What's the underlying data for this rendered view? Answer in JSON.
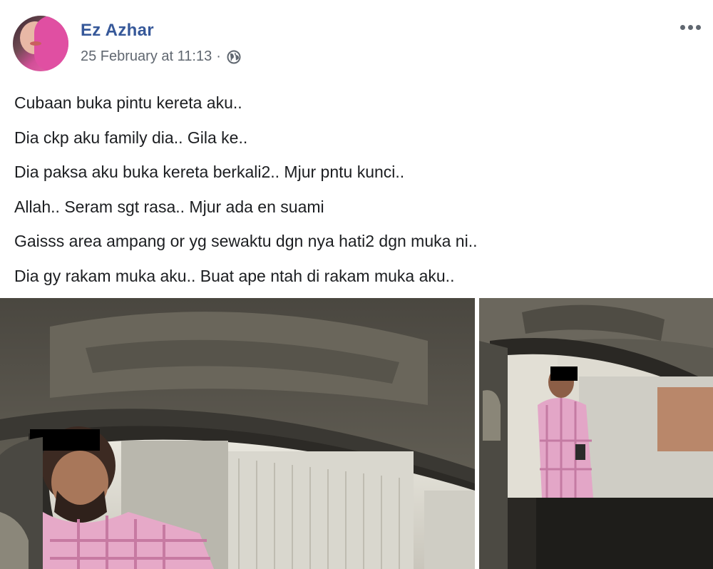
{
  "post": {
    "author": "Ez Azhar",
    "timestamp": "25 February at 11:13",
    "separator": "·",
    "privacy_icon": "globe-icon",
    "more_icon": "more-options-icon",
    "lines": [
      "Cubaan buka pintu kereta aku..",
      "Dia ckp aku family dia.. Gila ke..",
      "Dia paksa aku buka kereta berkali2.. Mjur pntu kunci..",
      "Allah.. Seram sgt rasa.. Mjur ada en suami",
      "Gaisss area ampang or yg sewaktu dgn nya hati2 dgn muka ni..",
      "Dia gy rakam muka aku.. Buat ape ntah di rakam muka aku.."
    ]
  },
  "colors": {
    "author_link": "#365899",
    "meta_text": "#606770",
    "body_text": "#1c1e21"
  }
}
